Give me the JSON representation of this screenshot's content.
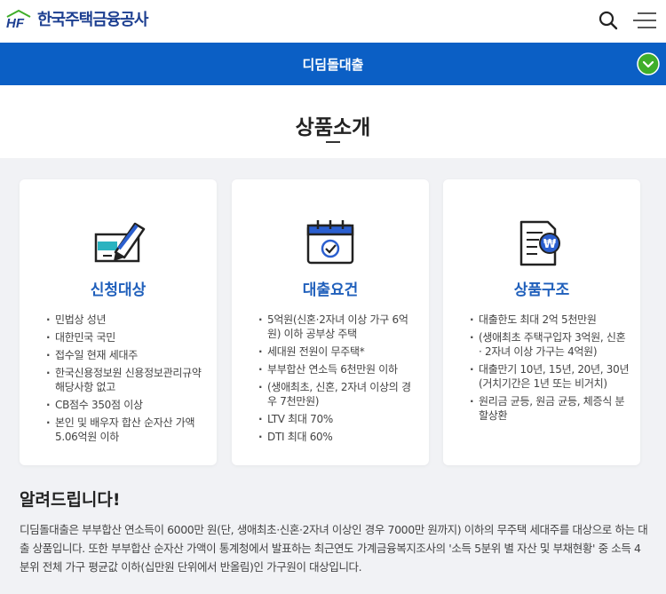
{
  "header": {
    "logo_text": "한국주택금융공사",
    "logo_mark": "HF",
    "search_icon": "search-icon",
    "menu_icon": "menu-icon"
  },
  "colors": {
    "brand_blue": "#1d3f91",
    "bar_blue": "#0b5fc5",
    "accent_green": "#3fae2a",
    "title_blue": "#1f5fbb"
  },
  "bar": {
    "title": "디딤돌대출",
    "check_icon": "check-circle-icon"
  },
  "page": {
    "title": "상품소개"
  },
  "cards": [
    {
      "icon": "pen-form-icon",
      "title": "신청대상",
      "items": [
        "민법상 성년",
        "대한민국 국민",
        "접수일 현재 세대주",
        "한국신용정보원 신용정보관리규약 해당사항 없고",
        "CB점수 350점 이상",
        "본인 및 배우자 합산 순자산 가액 5.06억원 이하"
      ]
    },
    {
      "icon": "calendar-check-icon",
      "title": "대출요건",
      "items": [
        "5억원(신혼·2자녀 이상 가구 6억원) 이하 공부상 주택",
        "세대원 전원이 무주택*",
        "부부합산 연소득 6천만원 이하",
        "(생애최초, 신혼, 2자녀 이상의 경우 7천만원)",
        "LTV 최대 70%",
        "DTI 최대 60%"
      ]
    },
    {
      "icon": "document-won-icon",
      "title": "상품구조",
      "items": [
        "대출한도 최대 2억 5천만원",
        "(생애최초 주택구입자 3억원, 신혼 · 2자녀 이상 가구는 4억원)",
        "대출만기 10년, 15년, 20년, 30년 (거치기간은 1년 또는 비거치)",
        "원리금 균등, 원금 균등, 체증식 분할상환"
      ]
    }
  ],
  "notice": {
    "title": "알려드립니다!",
    "text": "디딤돌대출은 부부합산 연소득이 6000만 원(단, 생애최초·신혼·2자녀 이상인 경우 7000만 원까지) 이하의 무주택 세대주를 대상으로 하는 대출 상품입니다. 또한 부부합산 순자산 가액이 통계청에서 발표하는 최근연도 가계금융복지조사의 '소득 5분위 별 자산 및 부채현황' 중 소득 4분위 전체 가구 평균값 이하(십만원 단위에서 반올림)인 가구원이 대상입니다."
  }
}
